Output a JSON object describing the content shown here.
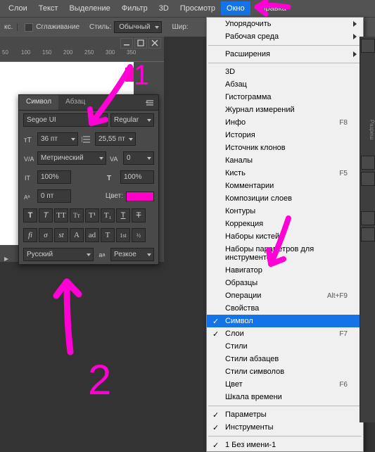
{
  "menubar": {
    "items": [
      "Слои",
      "Текст",
      "Выделение",
      "Фильтр",
      "3D",
      "Просмотр",
      "Окно",
      "Справка"
    ],
    "active_index": 6
  },
  "toolbar": {
    "anti_alias": "Сглаживание",
    "style_label": "Стиль:",
    "style_value": "Обычный",
    "width_label": "Шир:"
  },
  "ruler": {
    "marks": [
      "50",
      "100",
      "150",
      "200",
      "250",
      "300",
      "350"
    ]
  },
  "char_panel": {
    "tab_symbol": "Символ",
    "tab_paragraph": "Абзац",
    "font_family": "Segoe UI",
    "font_style": "Regular",
    "font_size": "36 пт",
    "leading": "25,55 пт",
    "tracking_mode": "Метрический",
    "tracking": "0",
    "vscale": "100%",
    "hscale": "100%",
    "baseline": "0 пт",
    "color_label": "Цвет:",
    "color": "#ff00c8",
    "language": "Русский",
    "aa": "Резкое"
  },
  "window_menu": [
    {
      "label": "Упорядочить",
      "submenu": true
    },
    {
      "label": "Рабочая среда",
      "submenu": true
    },
    {
      "sep": true
    },
    {
      "label": "Расширения",
      "submenu": true
    },
    {
      "sep": true
    },
    {
      "label": "3D"
    },
    {
      "label": "Абзац"
    },
    {
      "label": "Гистограмма"
    },
    {
      "label": "Журнал измерений"
    },
    {
      "label": "Инфо",
      "shortcut": "F8"
    },
    {
      "label": "История"
    },
    {
      "label": "Источник клонов"
    },
    {
      "label": "Каналы"
    },
    {
      "label": "Кисть",
      "shortcut": "F5"
    },
    {
      "label": "Комментарии"
    },
    {
      "label": "Композиции слоев"
    },
    {
      "label": "Контуры"
    },
    {
      "label": "Коррекция"
    },
    {
      "label": "Наборы кистей"
    },
    {
      "label": "Наборы параметров для инструментов"
    },
    {
      "label": "Навигатор"
    },
    {
      "label": "Образцы"
    },
    {
      "label": "Операции",
      "shortcut": "Alt+F9"
    },
    {
      "label": "Свойства"
    },
    {
      "label": "Символ",
      "checked": true,
      "selected": true
    },
    {
      "label": "Слои",
      "checked": true,
      "shortcut": "F7"
    },
    {
      "label": "Стили"
    },
    {
      "label": "Стили абзацев"
    },
    {
      "label": "Стили символов"
    },
    {
      "label": "Цвет",
      "shortcut": "F6"
    },
    {
      "label": "Шкала времени"
    },
    {
      "sep": true
    },
    {
      "label": "Параметры",
      "checked": true
    },
    {
      "label": "Инструменты",
      "checked": true
    },
    {
      "sep": true
    },
    {
      "label": "1 Без имени-1",
      "checked": true
    }
  ],
  "right_hint": "Разреш",
  "annotation": {
    "color": "#ff00d5",
    "number_2": "2"
  }
}
